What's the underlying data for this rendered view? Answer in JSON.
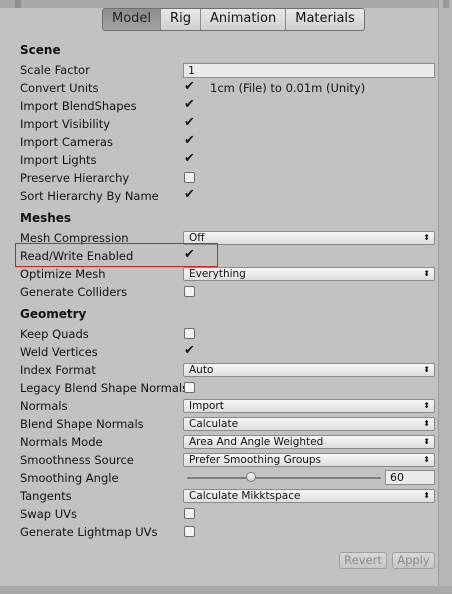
{
  "tabs": [
    {
      "label": "Model",
      "active": true
    },
    {
      "label": "Rig",
      "active": false
    },
    {
      "label": "Animation",
      "active": false
    },
    {
      "label": "Materials",
      "active": false
    }
  ],
  "scene": {
    "title": "Scene",
    "scale_factor": {
      "label": "Scale Factor",
      "value": "1"
    },
    "convert_units": {
      "label": "Convert Units",
      "checked": true,
      "text": "1cm (File) to 0.01m (Unity)"
    },
    "import_blendshapes": {
      "label": "Import BlendShapes",
      "checked": true
    },
    "import_visibility": {
      "label": "Import Visibility",
      "checked": true
    },
    "import_cameras": {
      "label": "Import Cameras",
      "checked": true
    },
    "import_lights": {
      "label": "Import Lights",
      "checked": true
    },
    "preserve_hierarchy": {
      "label": "Preserve Hierarchy",
      "checked": false
    },
    "sort_hierarchy": {
      "label": "Sort Hierarchy By Name",
      "checked": true
    }
  },
  "meshes": {
    "title": "Meshes",
    "mesh_compression": {
      "label": "Mesh Compression",
      "value": "Off"
    },
    "read_write": {
      "label": "Read/Write Enabled",
      "checked": true
    },
    "optimize_mesh": {
      "label": "Optimize Mesh",
      "value": "Everything"
    },
    "generate_colliders": {
      "label": "Generate Colliders",
      "checked": false
    }
  },
  "geometry": {
    "title": "Geometry",
    "keep_quads": {
      "label": "Keep Quads",
      "checked": false
    },
    "weld_vertices": {
      "label": "Weld Vertices",
      "checked": true
    },
    "index_format": {
      "label": "Index Format",
      "value": "Auto"
    },
    "legacy_blend": {
      "label": "Legacy Blend Shape Normals",
      "checked": false
    },
    "normals": {
      "label": "Normals",
      "value": "Import"
    },
    "blend_shape_normals": {
      "label": "Blend Shape Normals",
      "value": "Calculate"
    },
    "normals_mode": {
      "label": "Normals Mode",
      "value": "Area And Angle Weighted"
    },
    "smoothness_source": {
      "label": "Smoothness Source",
      "value": "Prefer Smoothing Groups"
    },
    "smoothing_angle": {
      "label": "Smoothing Angle",
      "value": "60",
      "fraction": 0.33
    },
    "tangents": {
      "label": "Tangents",
      "value": "Calculate Mikktspace"
    },
    "swap_uvs": {
      "label": "Swap UVs",
      "checked": false
    },
    "generate_lightmap_uvs": {
      "label": "Generate Lightmap UVs",
      "checked": false
    }
  },
  "buttons": {
    "revert": "Revert",
    "apply": "Apply"
  },
  "icons": {
    "check": "✔",
    "dropdown_arrow": "⬍"
  },
  "colors": {
    "highlight": "#e01b1b",
    "background": "#c2c2c2"
  }
}
